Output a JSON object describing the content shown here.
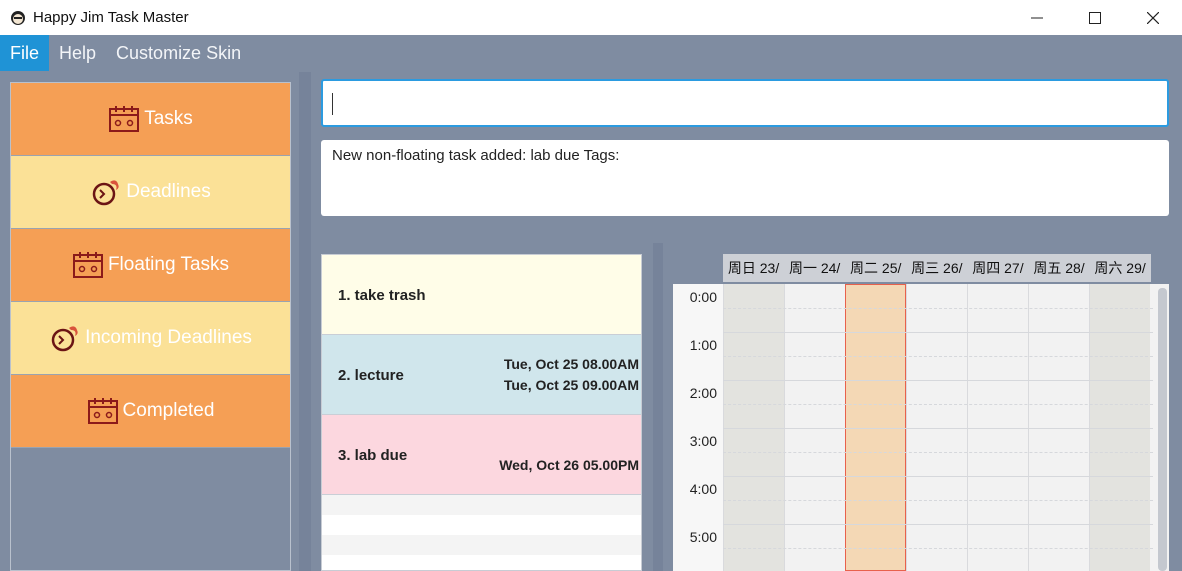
{
  "window": {
    "title": "Happy Jim Task Master",
    "controls": [
      "minimize-icon",
      "maximize-icon",
      "close-icon"
    ]
  },
  "menu": {
    "items": [
      {
        "label": "File",
        "active": true
      },
      {
        "label": "Help",
        "active": false
      },
      {
        "label": "Customize Skin",
        "active": false
      }
    ]
  },
  "sidebar": {
    "items": [
      {
        "label": "Tasks",
        "icon": "calendar-icon",
        "color": "#f59f55"
      },
      {
        "label": "Deadlines",
        "icon": "clock-fire-icon",
        "color": "#fbe197"
      },
      {
        "label": "Floating Tasks",
        "icon": "calendar-icon",
        "color": "#f59f55"
      },
      {
        "label": "Incoming Deadlines",
        "icon": "clock-fire-icon",
        "color": "#fbe197"
      },
      {
        "label": "Completed",
        "icon": "calendar-icon",
        "color": "#f59f55"
      }
    ]
  },
  "command": {
    "value": "",
    "result": "New non-floating task added: lab due Tags:"
  },
  "tasks": [
    {
      "name": "1. take trash",
      "dates": [],
      "color": "#fffde8"
    },
    {
      "name": "2. lecture",
      "dates": [
        "Tue, Oct 25 08.00AM",
        "Tue, Oct 25 09.00AM"
      ],
      "color": "#d0e6ec"
    },
    {
      "name": "3. lab due",
      "dates": [
        "Wed, Oct 26 05.00PM"
      ],
      "color": "#fcd7df"
    }
  ],
  "calendar": {
    "days": [
      "周日 23/",
      "周一 24/",
      "周二 25/",
      "周三 26/",
      "周四 27/",
      "周五 28/",
      "周六 29/"
    ],
    "today_index": 2,
    "times": [
      "0:00",
      "1:00",
      "2:00",
      "3:00",
      "4:00",
      "5:00"
    ]
  },
  "colors": {
    "accent": "#1f93d6",
    "background": "#7f8ca1",
    "today_border": "#e8614c"
  }
}
